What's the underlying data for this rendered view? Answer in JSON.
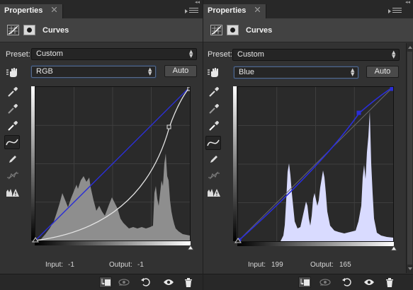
{
  "colors": {
    "panel_bg": "#323232",
    "histogram_rgb": "#8e8e8e",
    "histogram_blue": "#d9dbff",
    "blue_curve": "#2a2ed8",
    "rgb_curve": "#e4e4e4",
    "focus_ring": "#5a6c88"
  },
  "panels": [
    {
      "tab": "Properties",
      "title": "Curves",
      "preset_label": "Preset:",
      "preset_value": "Custom",
      "channel": "RGB",
      "auto_label": "Auto",
      "input_label": "Input:",
      "input_value": "-1",
      "output_label": "Output:",
      "output_value": "-1",
      "icons": [
        "curves-adjustment-icon",
        "layer-mask-icon",
        "targeted-adjustment-hand-icon",
        "eyedropper-black-icon",
        "eyedropper-gray-icon",
        "eyedropper-white-icon",
        "curve-edit-icon",
        "pencil-icon",
        "smooth-icon",
        "clipping-warning-icon"
      ]
    },
    {
      "tab": "Properties",
      "title": "Curves",
      "preset_label": "Preset:",
      "preset_value": "Custom",
      "channel": "Blue",
      "auto_label": "Auto",
      "input_label": "Input:",
      "input_value": "199",
      "output_label": "Output:",
      "output_value": "165",
      "icons": [
        "curves-adjustment-icon",
        "layer-mask-icon",
        "targeted-adjustment-hand-icon",
        "eyedropper-black-icon",
        "eyedropper-gray-icon",
        "eyedropper-white-icon",
        "curve-edit-icon",
        "pencil-icon",
        "smooth-icon",
        "clipping-warning-icon"
      ]
    }
  ],
  "bottom_icons": [
    "clip-to-layer-icon",
    "view-previous-icon",
    "reset-icon",
    "visibility-eye-icon",
    "delete-trash-icon"
  ],
  "curves": {
    "rgb_composite": [
      [
        0,
        0
      ],
      [
        187,
        145
      ],
      [
        255,
        255
      ]
    ],
    "blue_channel": [
      [
        0,
        0
      ],
      [
        199,
        165
      ],
      [
        255,
        255
      ]
    ]
  }
}
